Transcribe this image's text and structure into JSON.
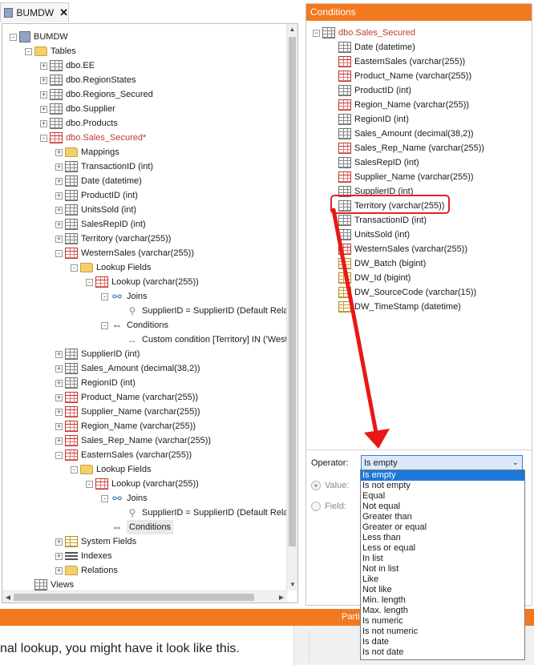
{
  "document_tab": {
    "label": "BUMDW",
    "close": "✕"
  },
  "left_tree": {
    "rows": [
      {
        "indent": 0,
        "text": "BUMDW",
        "icon": "db-icon",
        "exp": "-"
      },
      {
        "indent": 1,
        "text": "Tables",
        "icon": "tables-icon",
        "exp": "-"
      },
      {
        "indent": 2,
        "text": "dbo.EE",
        "icon": "table-icon",
        "exp": "+"
      },
      {
        "indent": 2,
        "text": "dbo.RegionStates",
        "icon": "table-icon",
        "exp": "+"
      },
      {
        "indent": 2,
        "text": "dbo.Regions_Secured",
        "icon": "table-icon",
        "exp": "+"
      },
      {
        "indent": 2,
        "text": "dbo.Supplier",
        "icon": "table-icon",
        "exp": "+"
      },
      {
        "indent": 2,
        "text": "dbo.Products",
        "icon": "table-icon",
        "exp": "+"
      },
      {
        "indent": 2,
        "text": "dbo.Sales_Secured*",
        "icon": "table-red-icon",
        "exp": "-",
        "red": true
      },
      {
        "indent": 3,
        "text": "Mappings",
        "icon": "folder-icon",
        "exp": "+"
      },
      {
        "indent": 3,
        "text": "TransactionID (int)",
        "icon": "key-column-icon",
        "exp": "+"
      },
      {
        "indent": 3,
        "text": "Date (datetime)",
        "icon": "column-icon",
        "exp": "+"
      },
      {
        "indent": 3,
        "text": "ProductID (int)",
        "icon": "column-icon",
        "exp": "+"
      },
      {
        "indent": 3,
        "text": "UnitsSold (int)",
        "icon": "column-icon",
        "exp": "+"
      },
      {
        "indent": 3,
        "text": "SalesRepID (int)",
        "icon": "column-icon",
        "exp": "+"
      },
      {
        "indent": 3,
        "text": "Territory (varchar(255))",
        "icon": "column-icon",
        "exp": "+"
      },
      {
        "indent": 3,
        "text": "WesternSales (varchar(255))",
        "icon": "column-red-icon",
        "exp": "-"
      },
      {
        "indent": 4,
        "text": "Lookup Fields",
        "icon": "folder-icon",
        "exp": "-"
      },
      {
        "indent": 5,
        "text": "Lookup (varchar(255))",
        "icon": "lookup-icon",
        "exp": "-"
      },
      {
        "indent": 6,
        "text": "Joins",
        "icon": "joins-icon",
        "exp": "-"
      },
      {
        "indent": 7,
        "text": "SupplierID = SupplierID (Default Relat",
        "icon": "link-icon",
        "exp": ""
      },
      {
        "indent": 6,
        "text": "Conditions",
        "icon": "conditions-icon",
        "exp": "-"
      },
      {
        "indent": 7,
        "text": "Custom condition [Territory] IN ('West'",
        "icon": "condition-item-icon",
        "exp": ""
      },
      {
        "indent": 3,
        "text": "SupplierID (int)",
        "icon": "column-icon",
        "exp": "+"
      },
      {
        "indent": 3,
        "text": "Sales_Amount (decimal(38,2))",
        "icon": "column-icon",
        "exp": "+"
      },
      {
        "indent": 3,
        "text": "RegionID (int)",
        "icon": "column-icon",
        "exp": "+"
      },
      {
        "indent": 3,
        "text": "Product_Name (varchar(255))",
        "icon": "column-red-icon",
        "exp": "+"
      },
      {
        "indent": 3,
        "text": "Supplier_Name (varchar(255))",
        "icon": "column-red-icon",
        "exp": "+"
      },
      {
        "indent": 3,
        "text": "Region_Name (varchar(255))",
        "icon": "column-red-icon",
        "exp": "+"
      },
      {
        "indent": 3,
        "text": "Sales_Rep_Name (varchar(255))",
        "icon": "column-red-icon",
        "exp": "+"
      },
      {
        "indent": 3,
        "text": "EasternSales (varchar(255))",
        "icon": "column-red-icon",
        "exp": "-"
      },
      {
        "indent": 4,
        "text": "Lookup Fields",
        "icon": "folder-icon",
        "exp": "-"
      },
      {
        "indent": 5,
        "text": "Lookup (varchar(255))",
        "icon": "lookup-icon",
        "exp": "-"
      },
      {
        "indent": 6,
        "text": "Joins",
        "icon": "joins-icon",
        "exp": "-"
      },
      {
        "indent": 7,
        "text": "SupplierID = SupplierID (Default Relat",
        "icon": "link-icon",
        "exp": ""
      },
      {
        "indent": 6,
        "text": "Conditions",
        "icon": "conditions-icon",
        "exp": "",
        "selected": true
      },
      {
        "indent": 3,
        "text": "System Fields",
        "icon": "system-fields-icon",
        "exp": "+"
      },
      {
        "indent": 3,
        "text": "Indexes",
        "icon": "indexes-icon",
        "exp": "+"
      },
      {
        "indent": 3,
        "text": "Relations",
        "icon": "folder-icon",
        "exp": "+"
      },
      {
        "indent": 1,
        "text": "Views",
        "icon": "views-icon",
        "exp": ""
      }
    ]
  },
  "conditions_panel": {
    "title": "Conditions",
    "rows": [
      {
        "text": "dbo.Sales_Secured",
        "root": true,
        "red": true,
        "icon": "table-icon"
      },
      {
        "text": "Date (datetime)",
        "icon": "column-icon"
      },
      {
        "text": "EasternSales (varchar(255))",
        "icon": "column-red-icon"
      },
      {
        "text": "Product_Name (varchar(255))",
        "icon": "column-red-icon"
      },
      {
        "text": "ProductID (int)",
        "icon": "column-icon"
      },
      {
        "text": "Region_Name (varchar(255))",
        "icon": "column-red-icon"
      },
      {
        "text": "RegionID (int)",
        "icon": "column-icon"
      },
      {
        "text": "Sales_Amount (decimal(38,2))",
        "icon": "column-icon"
      },
      {
        "text": "Sales_Rep_Name (varchar(255))",
        "icon": "column-red-icon"
      },
      {
        "text": "SalesRepID (int)",
        "icon": "column-icon"
      },
      {
        "text": "Supplier_Name (varchar(255))",
        "icon": "column-red-icon"
      },
      {
        "text": "SupplierID (int)",
        "icon": "column-icon"
      },
      {
        "text": "Territory (varchar(255))",
        "icon": "column-icon",
        "highlight": true
      },
      {
        "text": "TransactionID (int)",
        "icon": "key-column-icon"
      },
      {
        "text": "UnitsSold (int)",
        "icon": "column-icon"
      },
      {
        "text": "WesternSales (varchar(255))",
        "icon": "column-red-icon"
      },
      {
        "text": "DW_Batch (bigint)",
        "icon": "column-gold-icon"
      },
      {
        "text": "DW_Id (bigint)",
        "icon": "column-gold-icon"
      },
      {
        "text": "DW_SourceCode (varchar(15))",
        "icon": "column-gold-icon"
      },
      {
        "text": "DW_TimeStamp (datetime)",
        "icon": "column-gold-icon"
      }
    ],
    "operator_label": "Operator:",
    "operator_value": "Is empty",
    "value_label": "Value:",
    "field_label": "Field:"
  },
  "operator_options": [
    "Is empty",
    "Is not empty",
    "Equal",
    "Not equal",
    "Greater than",
    "Greater or equal",
    "Less than",
    "Less or equal",
    "In list",
    "Not in list",
    "Like",
    "Not like",
    "Min. length",
    "Max. length",
    "Is numeric",
    "Is not numeric",
    "Is date",
    "Is not date"
  ],
  "bottom": {
    "bar_label": "Parti",
    "text": "nal lookup, you might have it look like this."
  },
  "colors": {
    "accent_orange": "#f2791f",
    "red_text": "#c0392b",
    "highlight_red": "#e02424",
    "selection_blue": "#1e78d8"
  }
}
